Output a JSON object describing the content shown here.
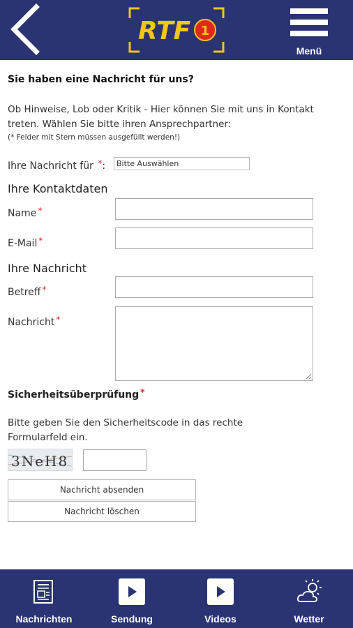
{
  "header": {
    "logo_text": "RTF",
    "logo_number": "1",
    "menu_label": "Menü"
  },
  "form": {
    "heading": "Sie haben eine Nachricht für uns?",
    "intro": "Ob Hinweise, Lob oder Kritik - Hier können Sie mit uns in Kontakt treten. Wählen Sie bitte ihren Ansprechpartner:",
    "required_hint": "(* Felder mit Stern müssen ausgefüllt werden!)",
    "recipient_label": "Ihre Nachricht für",
    "recipient_colon": ":",
    "recipient_value": "Bitte Auswählen",
    "required_marker": "*",
    "contact_section": "Ihre Kontaktdaten",
    "name_label": "Name",
    "email_label": "E-Mail",
    "message_section": "Ihre Nachricht",
    "subject_label": "Betreff",
    "message_label": "Nachricht",
    "security_section": "Sicherheitsüberprüfung",
    "security_text": "Bitte geben Sie den Sicherheitscode in das rechte Formularfeld ein.",
    "captcha_text": "3NeH8",
    "send_button": "Nachricht absenden",
    "clear_button": "Nachricht löschen"
  },
  "nav": {
    "items": [
      {
        "label": "Nachrichten",
        "icon": "newspaper-icon"
      },
      {
        "label": "Sendung",
        "icon": "play-icon"
      },
      {
        "label": "Videos",
        "icon": "play-icon"
      },
      {
        "label": "Wetter",
        "icon": "weather-icon"
      }
    ]
  },
  "colors": {
    "brand_blue": "#2a3473",
    "logo_yellow": "#f5c518",
    "logo_red": "#e0281e",
    "required_red": "#dd2222"
  }
}
